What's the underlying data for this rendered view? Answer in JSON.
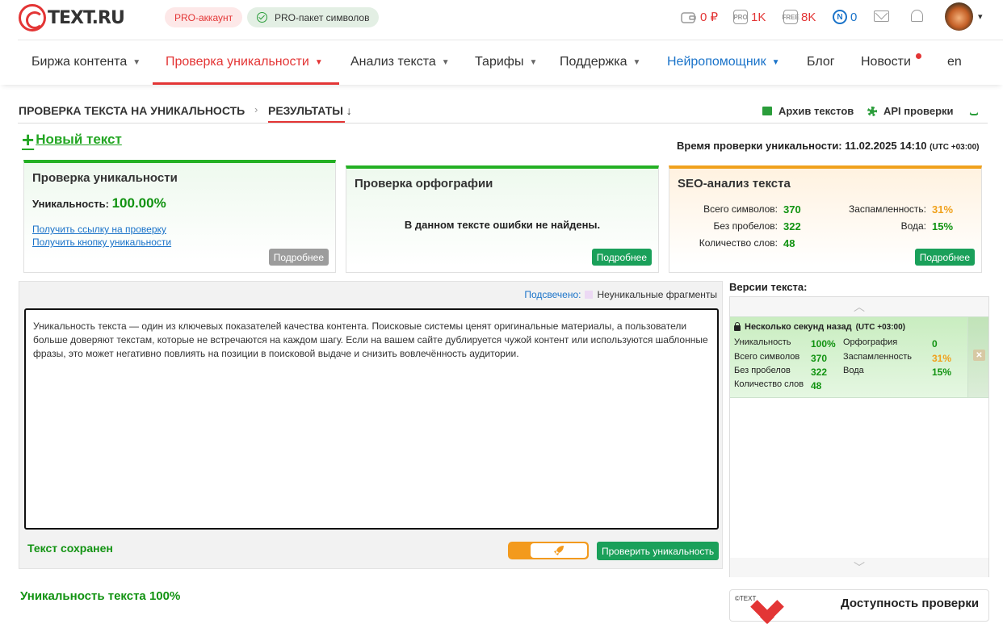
{
  "header": {
    "logo_text": "TEXT.RU",
    "pro_account": "PRO-аккаунт",
    "pro_package": "PRO-пакет символов",
    "balance": "0 ₽",
    "pro_symbols": "1K",
    "free_symbols": "8K",
    "neuro_tokens": "0",
    "pro_icon_label": "PRO",
    "free_icon_label": "FREE",
    "neuro_icon_label": "N"
  },
  "nav": {
    "items": [
      {
        "label": "Биржа контента"
      },
      {
        "label": "Проверка уникальности"
      },
      {
        "label": "Анализ текста"
      },
      {
        "label": "Тарифы"
      },
      {
        "label": "Поддержка"
      },
      {
        "label": "Нейропомощник"
      },
      {
        "label": "Блог"
      },
      {
        "label": "Новости"
      },
      {
        "label": "en"
      }
    ]
  },
  "breadcrumb": {
    "first": "ПРОВЕРКА ТЕКСТА НА УНИКАЛЬНОСТЬ",
    "second": "РЕЗУЛЬТАТЫ ↓",
    "archive": "Архив текстов",
    "api": "API проверки"
  },
  "new_text": "Новый текст",
  "check_time": {
    "label": "Время проверки уникальности: 11.02.2025 14:10",
    "tz": "(UTC +03:00)"
  },
  "card_uniq": {
    "title": "Проверка уникальности",
    "label": "Уникальность:",
    "value": "100.00%",
    "link1": "Получить ссылку на проверку",
    "link2": "Получить кнопку уникальности",
    "more": "Подробнее"
  },
  "card_spell": {
    "title": "Проверка орфографии",
    "message": "В данном тексте ошибки не найдены.",
    "more": "Подробнее"
  },
  "card_seo": {
    "title": "SEO-анализ текста",
    "total_label": "Всего символов:",
    "total": "370",
    "nospace_label": "Без пробелов:",
    "nospace": "322",
    "words_label": "Количество слов:",
    "words": "48",
    "spam_label": "Заспамленность:",
    "spam": "31%",
    "water_label": "Вода:",
    "water": "15%",
    "more": "Подробнее"
  },
  "editor": {
    "highlight_label": "Подсвечено:",
    "highlight_legend": "Неуникальные фрагменты",
    "text": "Уникальность текста — один из ключевых показателей качества контента. Поисковые системы ценят оригинальные материалы, а пользователи больше доверяют текстам, которые не встречаются на каждом шагу. Если на вашем сайте дублируется чужой контент или используются шаблонные фразы, это может негативно повлиять на позиции в поисковой выдаче и снизить вовлечённость аудитории.",
    "saved": "Текст сохранен",
    "check_button": "Проверить уникальность"
  },
  "result_line": "Уникальность текста 100%",
  "versions": {
    "title": "Версии текста:",
    "item": {
      "time": "Несколько секунд назад",
      "tz": "(UTC +03:00)",
      "uniq_label": "Уникальность",
      "uniq": "100%",
      "total_label": "Всего символов",
      "total": "370",
      "nospace_label": "Без пробелов",
      "nospace": "322",
      "words_label": "Количество слов",
      "words": "48",
      "spell_label": "Орфография",
      "spell": "0",
      "spam_label": "Заспамленность",
      "spam": "31%",
      "water_label": "Вода",
      "water": "15%"
    }
  },
  "availability": {
    "logo_text": "©TEXT",
    "title": "Доступность проверки"
  },
  "colors": {
    "brand_red": "#e33535",
    "green": "#129312",
    "button_green": "#1aa05a",
    "orange": "#f0a11c",
    "link_blue": "#1a73c9"
  }
}
